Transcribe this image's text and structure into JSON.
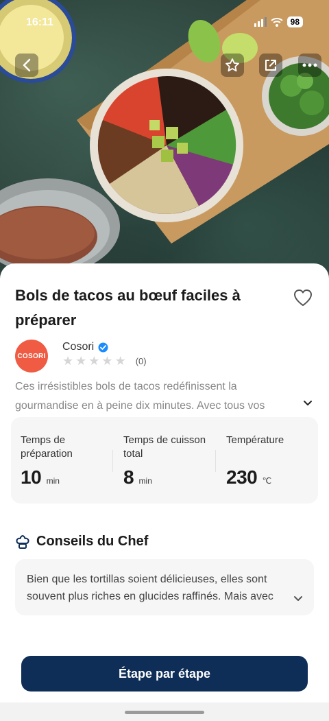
{
  "status_bar": {
    "time": "16:11",
    "battery": "98"
  },
  "recipe": {
    "title": "Bols de tacos au bœuf faciles à préparer",
    "author": {
      "name": "Cosori",
      "logo_text": "COSORI",
      "verified": true
    },
    "rating": {
      "stars": 0,
      "max_stars": 5,
      "count": "(0)"
    },
    "description": "Ces irrésistibles bols de tacos redéfinissent la gourmandise en à peine dix minutes. Avec tous vos"
  },
  "stats": [
    {
      "label": "Temps de préparation",
      "value": "10",
      "unit": "min"
    },
    {
      "label": "Temps de cuisson total",
      "value": "8",
      "unit": "min"
    },
    {
      "label": "Température",
      "value": "230",
      "unit": "℃"
    }
  ],
  "chef_tips": {
    "title": "Conseils du Chef",
    "text": "Bien que les tortillas soient délicieuses, elles sont souvent plus riches en glucides raffinés. Mais avec"
  },
  "actions": {
    "step_by_step": "Étape par étape"
  },
  "colors": {
    "primary_button": "#0e2d57",
    "brand_logo": "#ef5b43",
    "verified_badge": "#1a8cff"
  },
  "icons": [
    "back-icon",
    "star-outline-icon",
    "share-icon",
    "more-icon",
    "heart-icon",
    "chevron-down-icon",
    "chef-hat-icon",
    "verified-icon"
  ]
}
